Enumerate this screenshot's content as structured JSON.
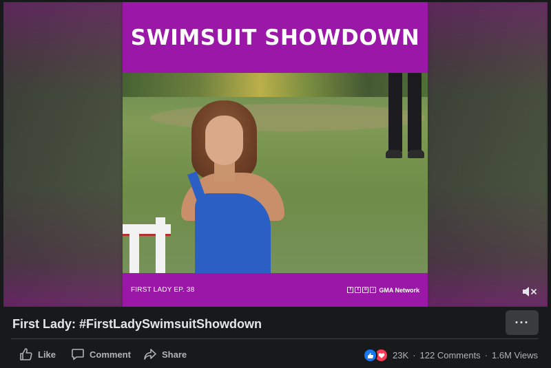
{
  "video": {
    "overlay_title": "SWIMSUIT SHOWDOWN",
    "episode_label": "FIRST LADY EP. 38",
    "network_label": "GMA Network",
    "social_icons": [
      "facebook-icon",
      "twitter-icon",
      "instagram-icon",
      "tiktok-icon"
    ],
    "mute_icon": "muted-speaker-icon",
    "accent_color": "#9b17a8"
  },
  "post": {
    "title": "First Lady: #FirstLadySwimsuitShowdown",
    "more_label": "···"
  },
  "actions": {
    "like_label": "Like",
    "comment_label": "Comment",
    "share_label": "Share"
  },
  "stats": {
    "reactions": "23K",
    "dot1": "·",
    "comments": "122 Comments",
    "dot2": "·",
    "views": "1.6M Views"
  }
}
